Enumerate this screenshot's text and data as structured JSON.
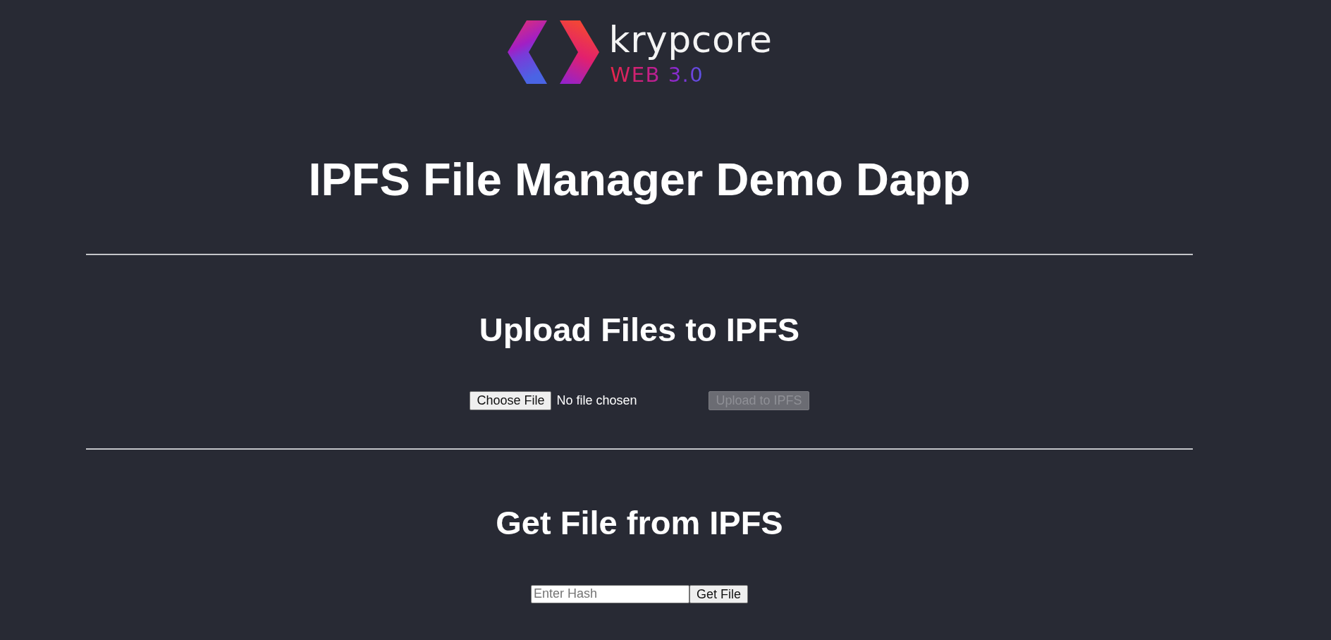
{
  "logo": {
    "wordmark": "krypcore",
    "tagline": "WEB 3.0"
  },
  "title": "IPFS File Manager Demo Dapp",
  "upload": {
    "heading": "Upload Files to IPFS",
    "choose_button": "Choose File",
    "file_status": "No file chosen",
    "upload_button": {
      "label": "Upload to IPFS",
      "disabled": true
    }
  },
  "get_file": {
    "heading": "Get File from IPFS",
    "hash_field": {
      "placeholder": "Enter Hash"
    },
    "get_button": "Get File"
  }
}
